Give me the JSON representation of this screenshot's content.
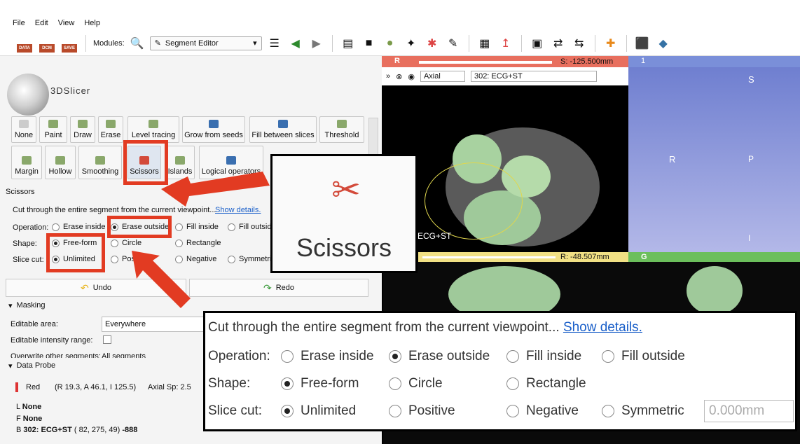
{
  "menu": [
    "File",
    "Edit",
    "View",
    "Help"
  ],
  "toolbar": {
    "data_label": "DATA",
    "dcm_label": "DCM",
    "save_label": "SAVE",
    "modules_label": "Modules:",
    "module_value": "Segment Editor"
  },
  "logo_text": "3DSlicer",
  "effects_row1": [
    "None",
    "Paint",
    "Draw",
    "Erase",
    "Level tracing",
    "Grow from seeds",
    "Fill between slices",
    "Threshold"
  ],
  "effects_row2": [
    "Margin",
    "Hollow",
    "Smoothing",
    "Scissors",
    "Islands",
    "Logical operators"
  ],
  "section_title": "Scissors",
  "description": "Cut through the entire segment from the current viewpoint...",
  "show_details": "Show details.",
  "operation": {
    "label": "Operation:",
    "options": [
      "Erase inside",
      "Erase outside",
      "Fill inside",
      "Fill outside"
    ]
  },
  "shape": {
    "label": "Shape:",
    "options": [
      "Free-form",
      "Circle",
      "Rectangle"
    ]
  },
  "slice_cut": {
    "label": "Slice cut:",
    "options": [
      "Unlimited",
      "Positive",
      "Negative",
      "Symmetric"
    ],
    "thickness": "0.000mm"
  },
  "undo": "Undo",
  "redo": "Redo",
  "masking": {
    "title": "Masking",
    "editable_area_label": "Editable area:",
    "editable_area_value": "Everywhere",
    "intensity_label": "Editable intensity range:",
    "overwrite_label": "Overwrite other segments:",
    "overwrite_value": "All segments"
  },
  "data_probe": {
    "title": "Data Probe",
    "layer": "Red",
    "coords": "(R 19.3, A 46.1, I 125.5)",
    "spacing": "Axial Sp: 2.5",
    "L": "None",
    "F": "None",
    "B_name": "302: ECG+ST",
    "B_coords": "( 82, 275,  49)",
    "B_value": "-888"
  },
  "views": {
    "red_letter": "R",
    "red_offset": "S: -125.500mm",
    "orientation": "Axial",
    "volume": "302: ECG+ST",
    "ecg_overlay": "ECG+ST",
    "yellow_offset": "R: -48.507mm",
    "green_letter": "G",
    "blue_letter": "1",
    "axis_S": "S",
    "axis_R": "R",
    "axis_P": "P",
    "axis_I": "I"
  },
  "zoom_label": "Scissors",
  "accent": "#e23b22"
}
